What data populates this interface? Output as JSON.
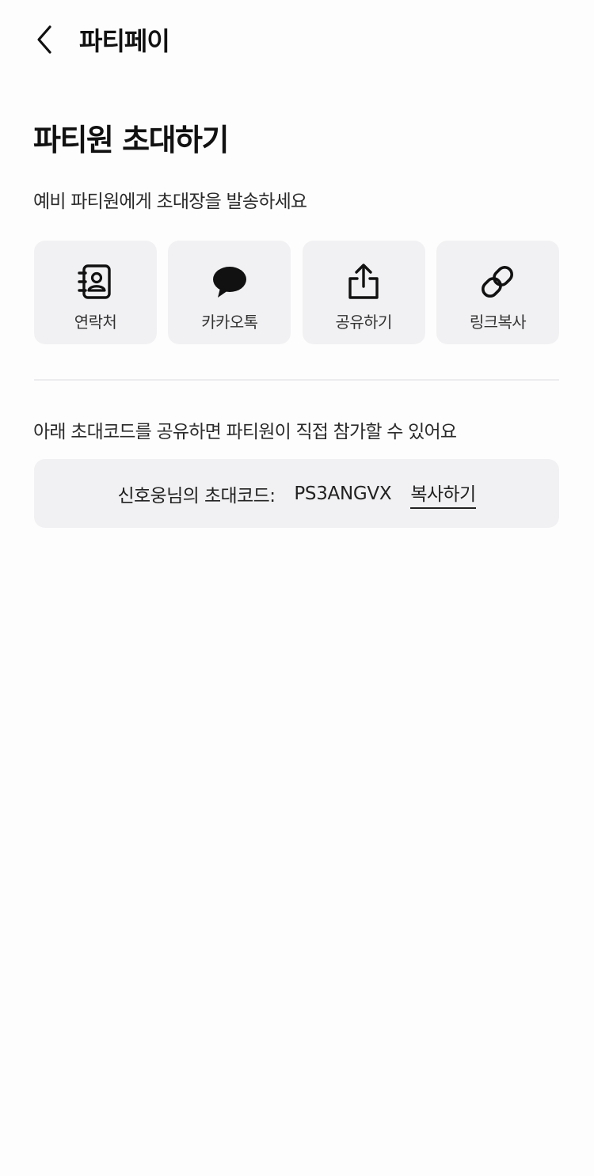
{
  "header": {
    "title": "파티페이",
    "back_icon": "chevron-left-icon"
  },
  "invite": {
    "title": "파티원 초대하기",
    "subtitle": "예비 파티원에게 초대장을 발송하세요",
    "share_options": [
      {
        "label": "연락처",
        "icon": "contact-book-icon"
      },
      {
        "label": "카카오톡",
        "icon": "kakaotalk-icon"
      },
      {
        "label": "공유하기",
        "icon": "share-icon"
      },
      {
        "label": "링크복사",
        "icon": "link-icon"
      }
    ]
  },
  "code_section": {
    "info": "아래 초대코드를 공유하면 파티원이 직접 참가할 수 있어요",
    "label": "신호웅님의 초대코드:",
    "code": "PS3ANGVX",
    "copy_label": "복사하기"
  },
  "colors": {
    "background": "#fdfdfd",
    "card": "#f1f1f3",
    "text": "#111111"
  }
}
